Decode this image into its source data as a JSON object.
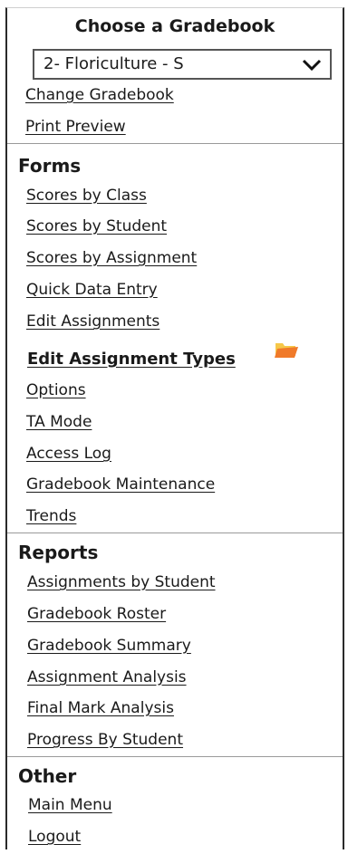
{
  "gradebook": {
    "title": "Choose a Gradebook",
    "selected": "2- Floriculture - S",
    "links": [
      "Change Gradebook",
      "Print Preview"
    ]
  },
  "forms": {
    "title": "Forms",
    "items": [
      "Scores by Class",
      "Scores by Student",
      "Scores by Assignment",
      "Quick Data Entry",
      "Edit Assignments",
      "Edit Assignment Types",
      "Options",
      "TA Mode",
      "Access Log",
      "Gradebook Maintenance",
      "Trends"
    ]
  },
  "reports": {
    "title": "Reports",
    "items": [
      "Assignments by Student",
      "Gradebook Roster",
      "Gradebook Summary",
      "Assignment Analysis",
      "Final Mark Analysis",
      "Progress By Student"
    ]
  },
  "other": {
    "title": "Other",
    "items": [
      "Main Menu",
      "Logout"
    ]
  },
  "icons": {
    "folder": "folder-icon",
    "dropdown": "chevron-down-icon"
  },
  "colors": {
    "folder_orange": "#f07a2a",
    "folder_yellow": "#f6c84a",
    "divider": "#9a9a9a"
  }
}
